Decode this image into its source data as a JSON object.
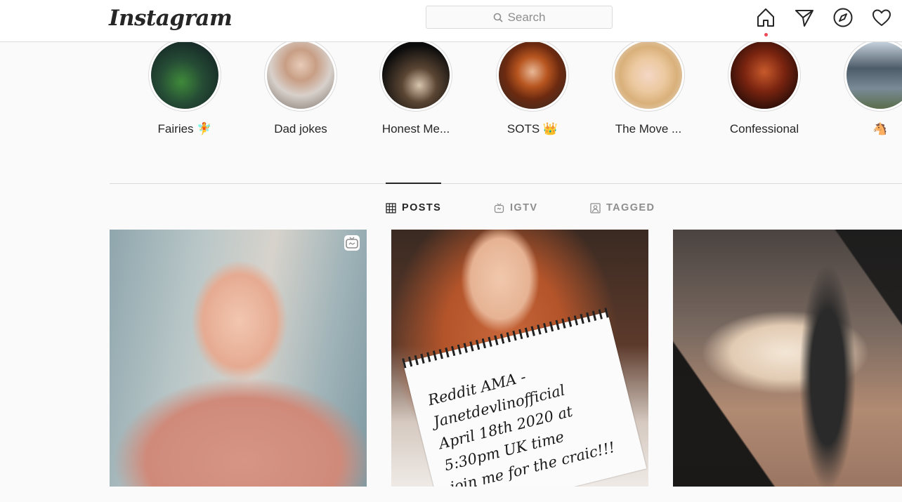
{
  "header": {
    "logo": "Instagram",
    "search_placeholder": "Search",
    "icons": [
      "home-icon",
      "direct-icon",
      "explore-icon",
      "activity-heart-icon"
    ]
  },
  "highlights": [
    {
      "label": "Fairies 🧚",
      "colors": [
        "#1f3b2f",
        "#2f7d3a"
      ]
    },
    {
      "label": "Dad jokes",
      "colors": [
        "#d9cfc8",
        "#6b5a50"
      ]
    },
    {
      "label": "Honest Me...",
      "colors": [
        "#0d0d0d",
        "#4a3a2c"
      ]
    },
    {
      "label": "SOTS 👑",
      "colors": [
        "#2c2620",
        "#b5521f"
      ]
    },
    {
      "label": "The Move ...",
      "colors": [
        "#efe6de",
        "#e0b58b"
      ]
    },
    {
      "label": "Confessional",
      "colors": [
        "#1b0b08",
        "#8a2a12"
      ]
    },
    {
      "label": "🐴",
      "colors": [
        "#3d4a57",
        "#8fa0ad"
      ]
    }
  ],
  "tabs": [
    {
      "label": "POSTS",
      "icon": "grid-icon",
      "active": true
    },
    {
      "label": "IGTV",
      "icon": "igtv-icon",
      "active": false
    },
    {
      "label": "TAGGED",
      "icon": "tagged-icon",
      "active": false
    }
  ],
  "posts": [
    {
      "type": "igtv-video",
      "colors": [
        "#b9c6c8",
        "#d99a88"
      ]
    },
    {
      "type": "photo",
      "note_text": "Reddit AMA - Janetdevlinofficial\nApril 18th 2020 at 5:30pm UK time\njoin me for the craic!!!",
      "colors": [
        "#c46a3c",
        "#e9e2dc"
      ]
    },
    {
      "type": "photo",
      "colors": [
        "#3a3a3a",
        "#c9a08a"
      ]
    }
  ],
  "colors": {
    "accent_red": "#ed4956",
    "text": "#262626",
    "muted": "#8e8e8e",
    "border": "#dbdbdb"
  }
}
